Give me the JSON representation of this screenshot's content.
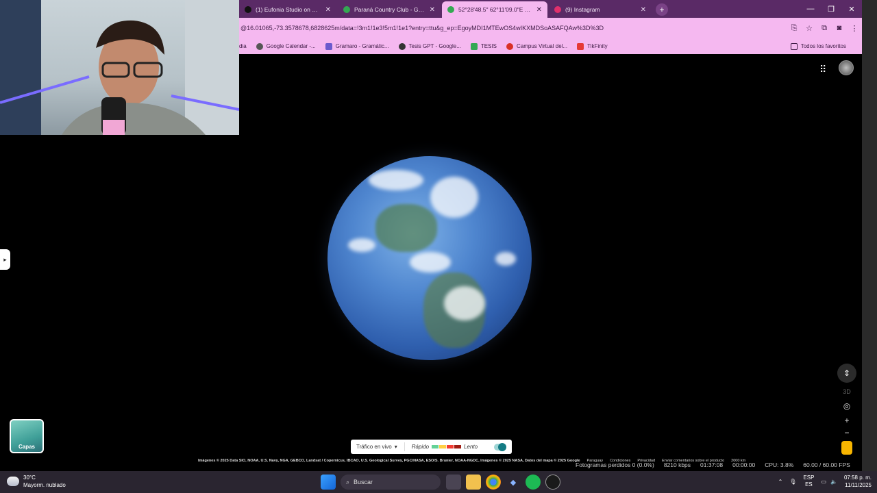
{
  "browser": {
    "tabs": [
      {
        "label": "(1) Eufonia Studio on X: \"Squid",
        "color": "#111111",
        "active": false
      },
      {
        "label": "Paraná Country Club - Google",
        "color": "#34a853",
        "active": false
      },
      {
        "label": "52°28'48.5\" 62°11'09.0\"E - Goo",
        "color": "#34a853",
        "active": true
      },
      {
        "label": "(9) Instagram",
        "color": "#e1306c",
        "active": false
      }
    ],
    "url": "@16.01065,-73.3578678,6828625m/data=!3m1!1e3!5m1!1e1?entry=ttu&g_ep=EgoyMDI1MTEwOS4wIKXMDSoASAFQAw%3D%3D",
    "bookmarks": [
      {
        "label": "dia",
        "color": "#555555"
      },
      {
        "label": "Google Calendar -...",
        "color": "#555555"
      },
      {
        "label": "Gramaro - Gramátic...",
        "color": "#6a5acd"
      },
      {
        "label": "Tesis GPT - Google...",
        "color": "#333333"
      },
      {
        "label": "TESIS",
        "color": "#34a853"
      },
      {
        "label": "Campus Virtual del...",
        "color": "#d93025"
      },
      {
        "label": "TikFinity",
        "color": "#e53935"
      }
    ],
    "all_bookmarks": "Todos los favoritos"
  },
  "map": {
    "traffic_label": "Tráfico en vivo",
    "fast_label": "Rápido",
    "slow_label": "Lento",
    "traffic_colors": [
      "#63d297",
      "#ffcf43",
      "#f23c32",
      "#a01c13"
    ],
    "layers_label": "Capas",
    "view_3d": "3D",
    "attribution": "Imágenes © 2025 Data SIO, NOAA, U.S. Navy, NGA, GEBCO, Landsat / Copernicus, IBCAO, U.S. Geological Survey, PGC/NASA, ESO/S. Brunier, NOAA-NGDC, Imágenes © 2025 NASA, Datos del mapa © 2025 Google",
    "attrib_links": [
      "Paraguay",
      "Condiciones",
      "Privacidad",
      "Enviar comentarios sobre el producto"
    ],
    "scale": "2000 km"
  },
  "obs": {
    "frames": "Fotogramas perdidos 0 (0.0%)",
    "bitrate": "8210 kbps",
    "time1": "01:37:08",
    "time2": "00:00:00",
    "cpu": "CPU: 3.8%",
    "fps": "60.00 / 60.00 FPS"
  },
  "taskbar": {
    "temp": "30°C",
    "weather": "Mayorm. nublado",
    "search": "Buscar",
    "lang1": "ESP",
    "lang2": "ES",
    "time": "07:58 p. m.",
    "date": "11/11/2025"
  }
}
